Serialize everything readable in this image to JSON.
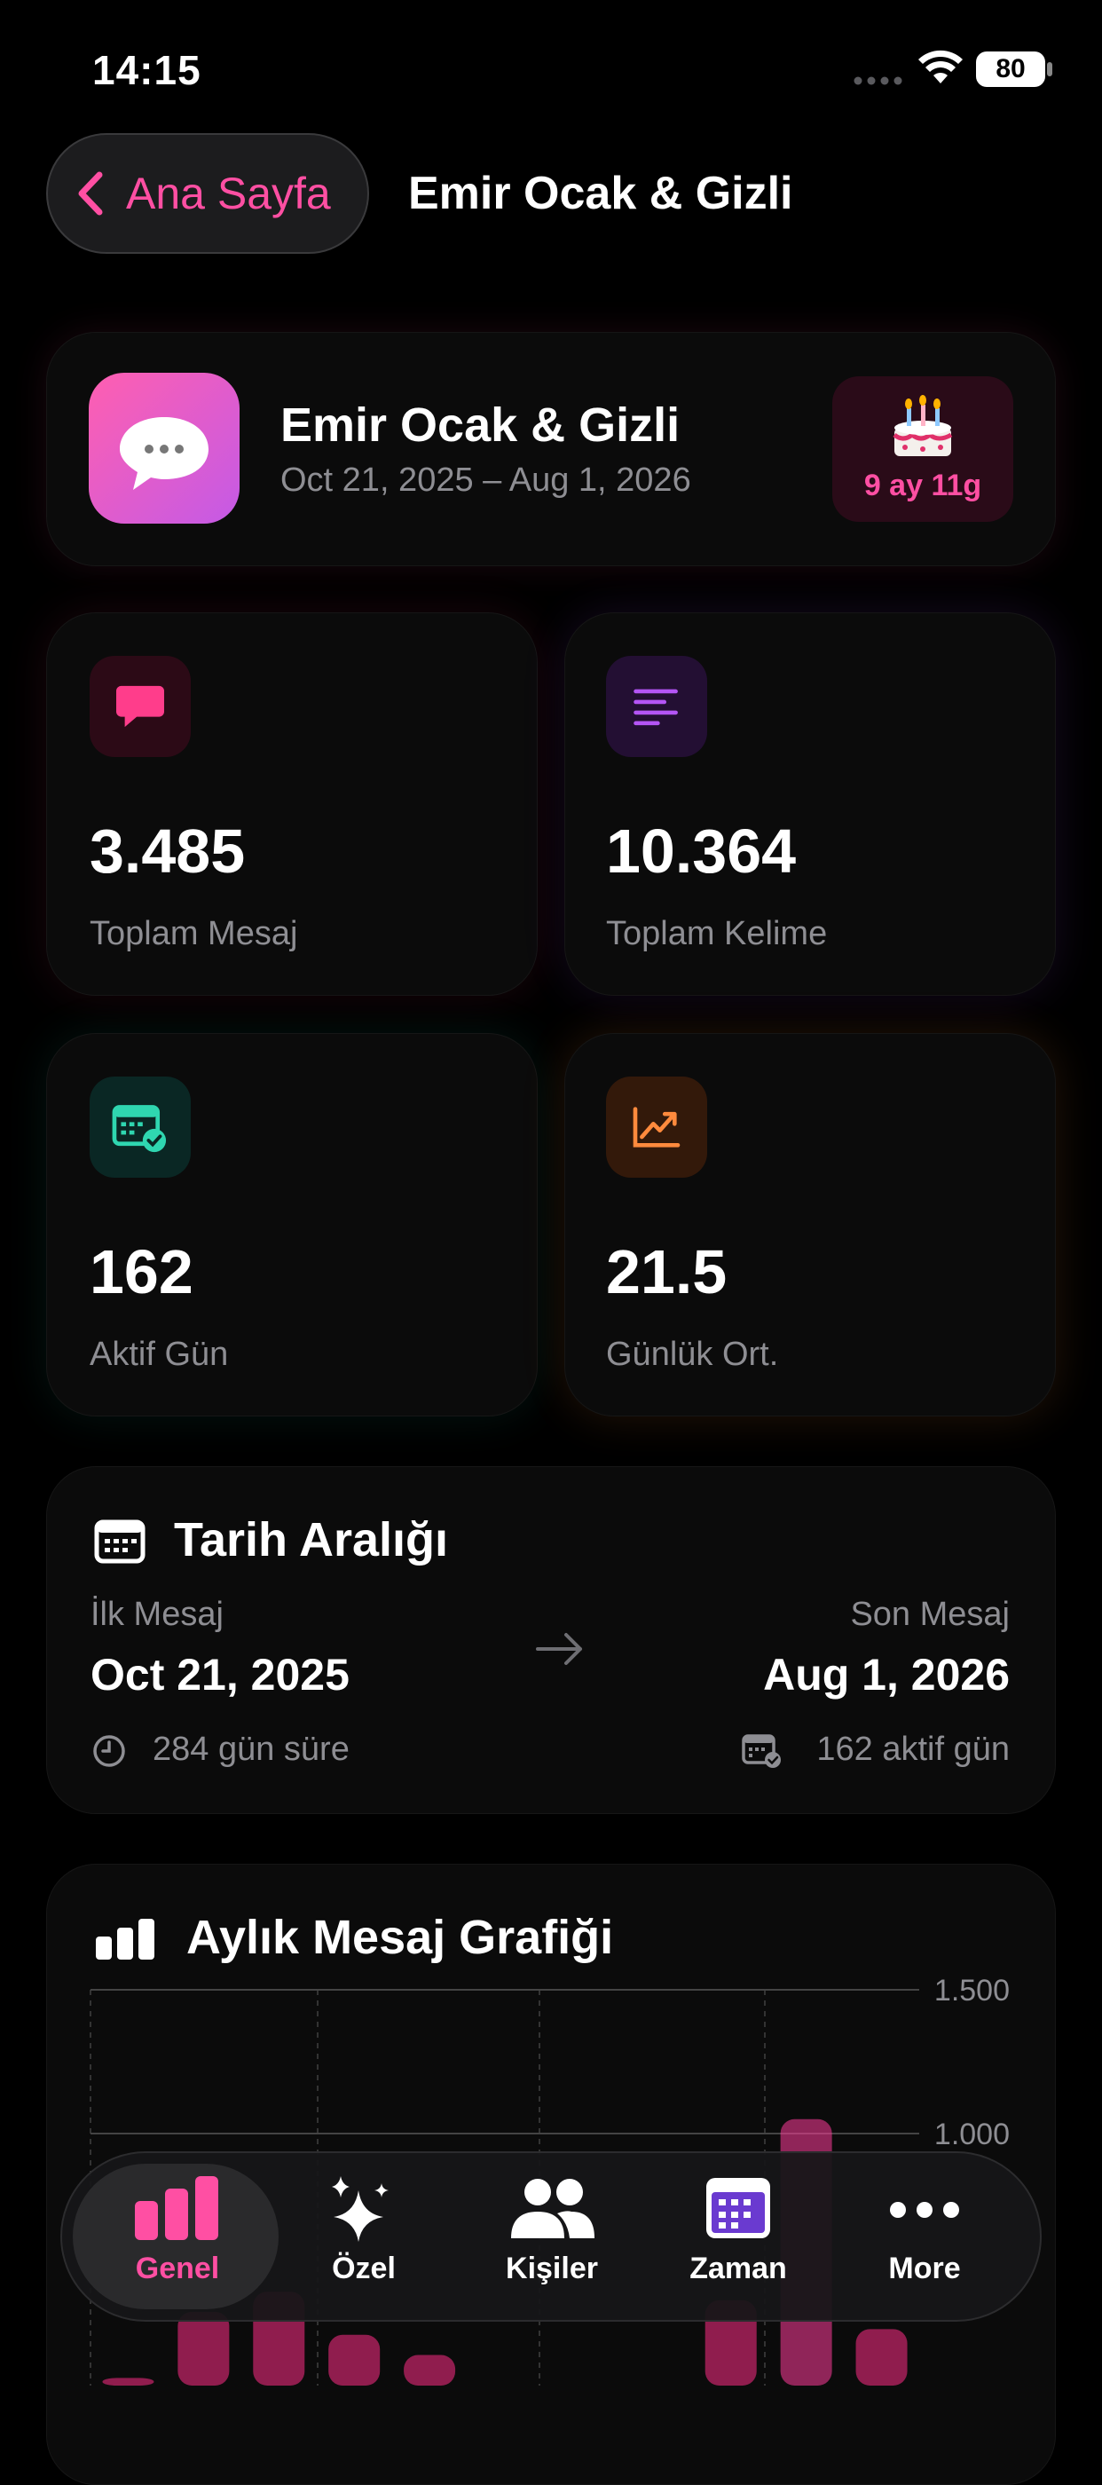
{
  "status_bar": {
    "time": "14:15",
    "battery": "80"
  },
  "header": {
    "back_label": "Ana Sayfa",
    "title": "Emir Ocak & Gizli"
  },
  "chat_card": {
    "name": "Emir Ocak & Gizli",
    "dates": "Oct 21, 2025 – Aug 1, 2026",
    "duration": "9 ay 11g"
  },
  "stats": [
    {
      "value": "3.485",
      "label": "Toplam Mesaj",
      "icon": "chat-bubble-icon",
      "color": "#ff3d8b"
    },
    {
      "value": "10.364",
      "label": "Toplam Kelime",
      "icon": "text-lines-icon",
      "color": "#b455f5"
    },
    {
      "value": "162",
      "label": "Aktif Gün",
      "icon": "calendar-check-icon",
      "color": "#2fd6b0"
    },
    {
      "value": "21.5",
      "label": "Günlük Ort.",
      "icon": "trend-up-icon",
      "color": "#ff8a3d"
    }
  ],
  "date_range": {
    "title": "Tarih Aralığı",
    "first_label": "İlk Mesaj",
    "first_date": "Oct 21, 2025",
    "last_label": "Son Mesaj",
    "last_date": "Aug 1, 2026",
    "duration_text": "284 gün süre",
    "active_text": "162 aktif gün"
  },
  "chart_card": {
    "title": "Aylık Mesaj Grafiği"
  },
  "chart_data": {
    "type": "bar",
    "title": "Aylık Mesaj Grafiği",
    "ylim": [
      0,
      1500
    ],
    "yticks": [
      "1.500",
      "1.000"
    ],
    "yticks_values": [
      1500,
      1000
    ],
    "values": [
      150,
      380,
      450,
      300,
      230,
      0,
      0,
      0,
      420,
      1050,
      320
    ],
    "colors": [
      "#ff2d87",
      "#ff2d87",
      "#ff2d87",
      "#ff2d87",
      "#ff2d87",
      "#ff2d87",
      "#ff2d87",
      "#ff2d87",
      "#ff2d87",
      "#ff3d9a",
      "#ff2d87"
    ]
  },
  "tabs": [
    {
      "label": "Genel",
      "icon": "bar-chart-icon",
      "active": true
    },
    {
      "label": "Özel",
      "icon": "sparkles-icon",
      "active": false
    },
    {
      "label": "Kişiler",
      "icon": "people-icon",
      "active": false
    },
    {
      "label": "Zaman",
      "icon": "calendar-icon",
      "active": false
    },
    {
      "label": "More",
      "icon": "more-dots-icon",
      "active": false
    }
  ],
  "colors": {
    "accent": "#ff4fa3",
    "background": "#000000"
  }
}
